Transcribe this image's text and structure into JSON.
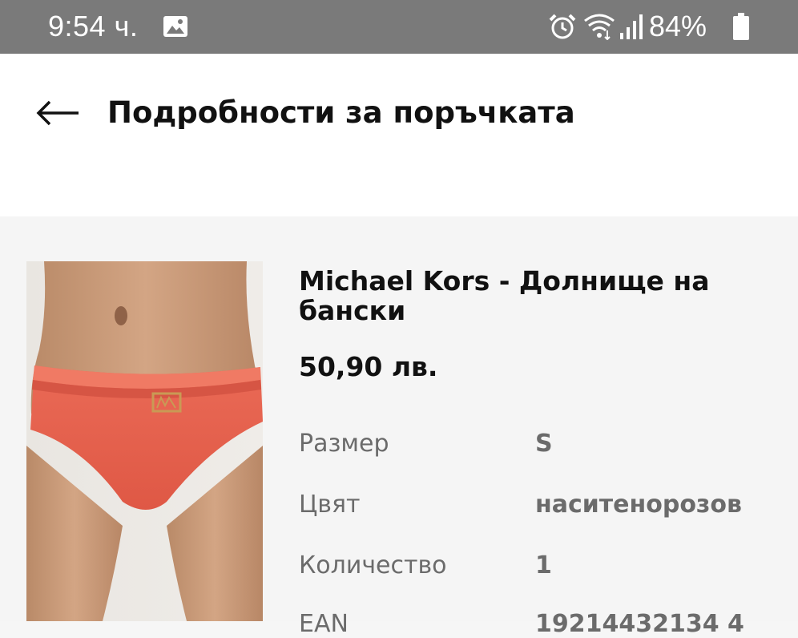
{
  "status_bar": {
    "time": "9:54 ч.",
    "battery": "84%",
    "icons": [
      "gallery-icon",
      "alarm-icon",
      "wifi-icon",
      "signal-icon",
      "battery-icon"
    ]
  },
  "header": {
    "title": "Подробности за поръчката",
    "back_icon": "arrow-left-icon"
  },
  "product": {
    "title": "Michael Kors - Долнище на бански",
    "price": "50,90 лв.",
    "attributes": [
      {
        "label": "Размер",
        "value": "S"
      },
      {
        "label": "Цвят",
        "value": "наситенорозов"
      },
      {
        "label": "Количество",
        "value": "1"
      },
      {
        "label": "EAN",
        "value": "19214432134 4"
      }
    ]
  },
  "colors": {
    "status_bar": "#7a7a7a",
    "header_bg": "#ffffff",
    "card_bg": "#f5f5f5",
    "product_coral": "#e85e4c"
  }
}
